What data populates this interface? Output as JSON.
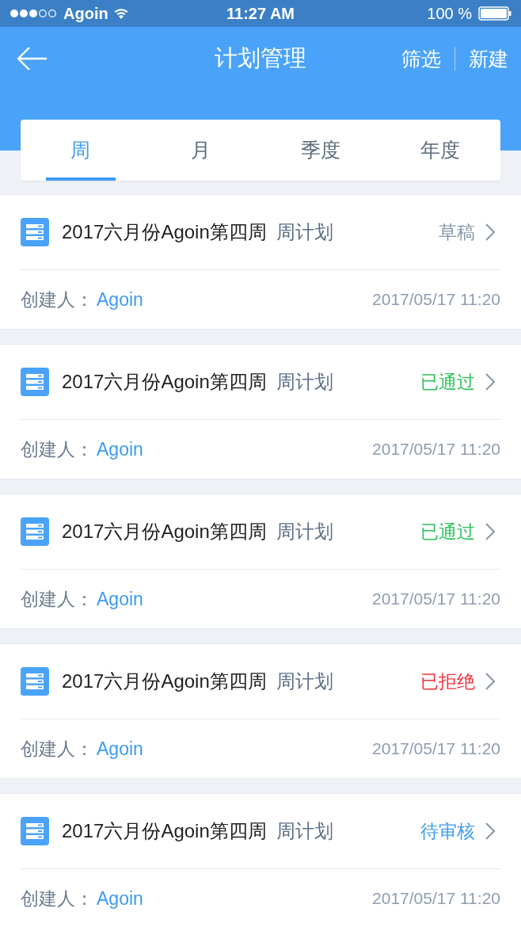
{
  "status_bar": {
    "carrier": "Agoin",
    "time": "11:27 AM",
    "battery": "100 %"
  },
  "header": {
    "title": "计划管理",
    "actions": [
      "筛选",
      "新建"
    ]
  },
  "tabs": [
    {
      "label": "周",
      "selected": true
    },
    {
      "label": "月",
      "selected": false
    },
    {
      "label": "季度",
      "selected": false
    },
    {
      "label": "年度",
      "selected": false
    }
  ],
  "plans": [
    {
      "title": "2017六月份Agoin第四周",
      "type": "周计划",
      "status": "草稿",
      "color": "#8495a8",
      "creator_label": "创建人：",
      "creator": "Agoin",
      "date": "2017/05/17 11:20"
    },
    {
      "title": "2017六月份Agoin第四周",
      "type": "周计划",
      "status": "已通过",
      "color": "#2fc25b",
      "creator_label": "创建人：",
      "creator": "Agoin",
      "date": "2017/05/17 11:20"
    },
    {
      "title": "2017六月份Agoin第四周",
      "type": "周计划",
      "status": "已通过",
      "color": "#2fc25b",
      "creator_label": "创建人：",
      "creator": "Agoin",
      "date": "2017/05/17 11:20"
    },
    {
      "title": "2017六月份Agoin第四周",
      "type": "周计划",
      "status": "已拒绝",
      "color": "#f5333f",
      "creator_label": "创建人：",
      "creator": "Agoin",
      "date": "2017/05/17 11:20"
    },
    {
      "title": "2017六月份Agoin第四周",
      "type": "周计划",
      "status": "待审核",
      "color": "#3d9bf2",
      "creator_label": "创建人：",
      "creator": "Agoin",
      "date": "2017/05/17 11:20"
    }
  ]
}
